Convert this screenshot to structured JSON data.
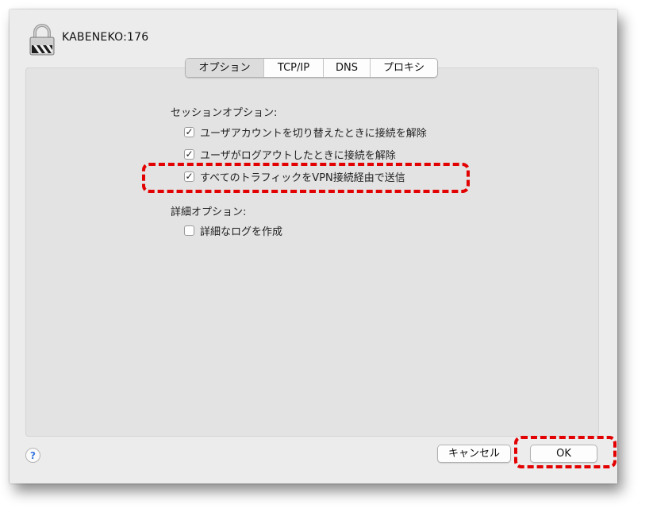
{
  "window": {
    "title": "KABENEKO:176"
  },
  "tabs": [
    {
      "label": "オプション",
      "selected": true
    },
    {
      "label": "TCP/IP",
      "selected": false
    },
    {
      "label": "DNS",
      "selected": false
    },
    {
      "label": "プロキシ",
      "selected": false
    }
  ],
  "session_options": {
    "heading": "セッションオプション:",
    "items": [
      {
        "label": "ユーザアカウントを切り替えたときに接続を解除",
        "checked": true,
        "mark": "✓"
      },
      {
        "label": "ユーザがログアウトしたときに接続を解除",
        "checked": true,
        "mark": "✓"
      },
      {
        "label": "すべてのトラフィックをVPN接続経由で送信",
        "checked": true,
        "mark": "✓"
      }
    ]
  },
  "advanced_options": {
    "heading": "詳細オプション:",
    "items": [
      {
        "label": "詳細なログを作成",
        "checked": false,
        "mark": ""
      }
    ]
  },
  "footer": {
    "help_label": "?",
    "cancel_label": "キャンセル",
    "ok_label": "OK"
  },
  "colors": {
    "highlight": "#e30000",
    "help_accent": "#3b7be0"
  },
  "icons": {
    "window_icon": "vpn-lock-icon"
  }
}
